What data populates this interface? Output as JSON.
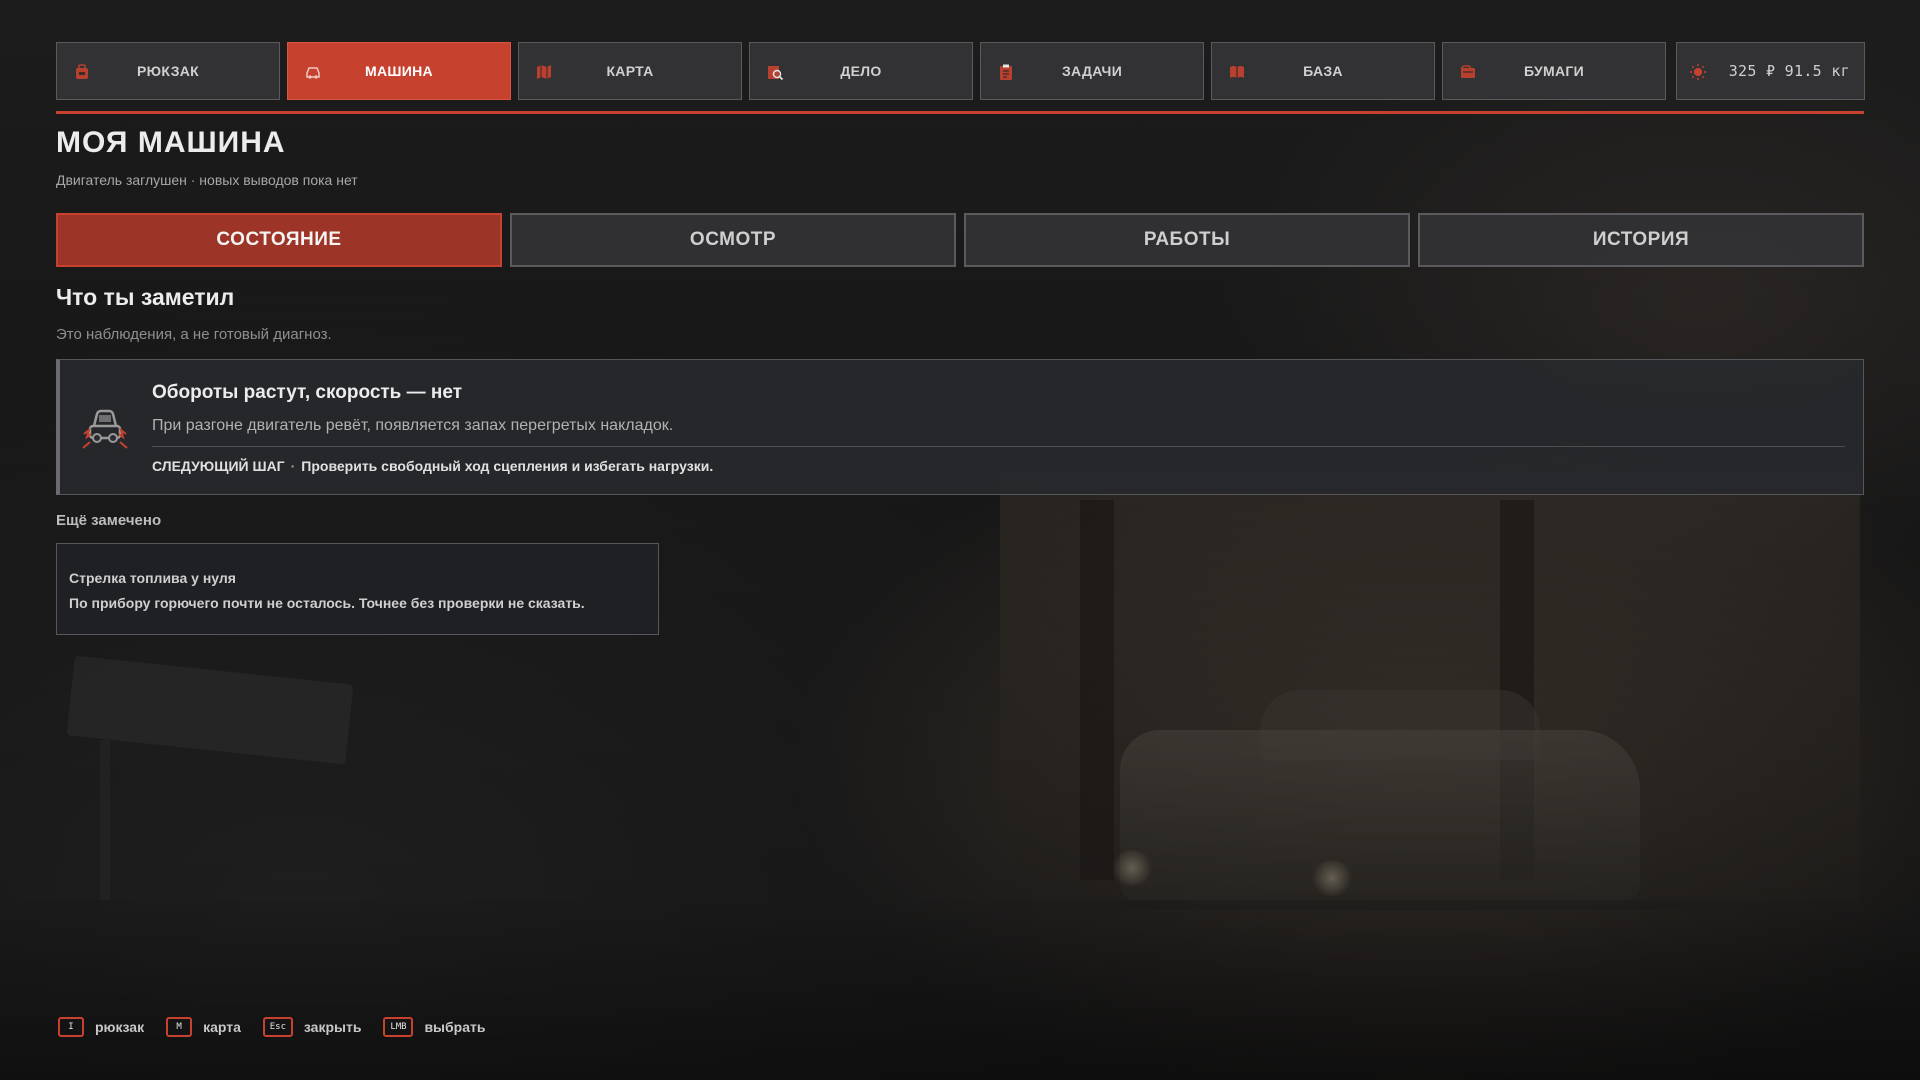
{
  "nav": {
    "tabs": [
      {
        "label": "РЮКЗАК",
        "icon": "backpack-icon",
        "active": false
      },
      {
        "label": "МАШИНА",
        "icon": "car-icon",
        "active": true
      },
      {
        "label": "КАРТА",
        "icon": "map-icon",
        "active": false
      },
      {
        "label": "ДЕЛО",
        "icon": "case-file-icon",
        "active": false
      },
      {
        "label": "ЗАДАЧИ",
        "icon": "clipboard-icon",
        "active": false
      },
      {
        "label": "БАЗА",
        "icon": "book-icon",
        "active": false
      },
      {
        "label": "БУМАГИ",
        "icon": "documents-icon",
        "active": false
      }
    ],
    "resources": {
      "text": "325 ₽ 91.5 кг",
      "icon": "sun-icon"
    }
  },
  "header": {
    "title": "МОЯ МАШИНА",
    "subtitle": "Двигатель заглушен · новых выводов пока нет"
  },
  "subtabs": [
    {
      "label": "СОСТОЯНИЕ",
      "active": true
    },
    {
      "label": "ОСМОТР",
      "active": false
    },
    {
      "label": "РАБОТЫ",
      "active": false
    },
    {
      "label": "ИСТОРИЯ",
      "active": false
    }
  ],
  "section": {
    "title": "Что ты заметил",
    "hint": "Это наблюдения, а не готовый диагноз."
  },
  "main_observation": {
    "icon": "car-warning-icon",
    "title": "Обороты растут, скорость — нет",
    "description": "При разгоне двигатель ревёт, появляется запах перегретых накладок.",
    "next_label": "СЛЕДУЮЩИЙ ШАГ",
    "next_separator": "·",
    "next_text": "Проверить свободный ход сцепления и избегать нагрузки."
  },
  "more": {
    "title": "Ещё замечено",
    "items": [
      {
        "title": "Стрелка топлива у нуля",
        "text": "По прибору горючего почти не осталось. Точнее без проверки не сказать."
      }
    ]
  },
  "hints": [
    {
      "key": "I",
      "label": "рюкзак"
    },
    {
      "key": "M",
      "label": "карта"
    },
    {
      "key": "Esc",
      "label": "закрыть"
    },
    {
      "key": "LMB",
      "label": "выбрать"
    }
  ],
  "colors": {
    "accent": "#c6422f",
    "active_subtab": "#9c3527",
    "panel": "#343436"
  }
}
